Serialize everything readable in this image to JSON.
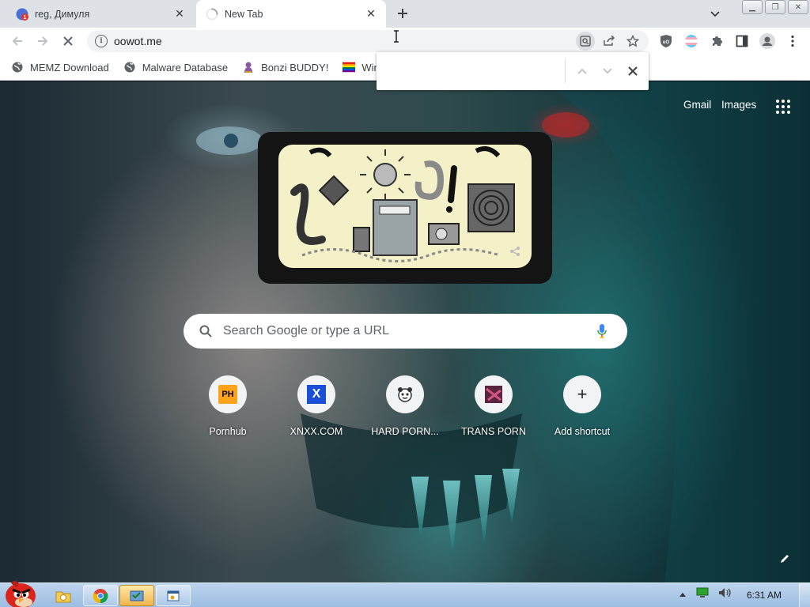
{
  "tabs": [
    {
      "title": "reg, Димуля",
      "favicon": "site-g-favicon",
      "active": false
    },
    {
      "title": "New Tab",
      "favicon": "loading-spinner-icon",
      "active": true
    }
  ],
  "toolbar": {
    "url": "oowot.me",
    "security_icon": "info-icon"
  },
  "bookmarks": [
    {
      "label": "MEMZ Download",
      "icon": "globe-icon"
    },
    {
      "label": "Malware Database",
      "icon": "globe-icon"
    },
    {
      "label": "Bonzi BUDDY!",
      "icon": "bonzi-icon"
    },
    {
      "label": "Wind",
      "icon": "windows-flag-icon"
    }
  ],
  "find_bar": {
    "value": ""
  },
  "ntp": {
    "gmail_label": "Gmail",
    "images_label": "Images",
    "search_placeholder": "Search Google or type a URL",
    "shortcuts": [
      {
        "label": "Pornhub",
        "fav_text": "PH"
      },
      {
        "label": "XNXX.COM",
        "fav_text": "X"
      },
      {
        "label": "HARD PORN...",
        "fav_text": ""
      },
      {
        "label": "TRANS PORN",
        "fav_text": ""
      },
      {
        "label": "Add shortcut",
        "fav_text": "+"
      }
    ]
  },
  "taskbar": {
    "clock": "6:31 AM"
  },
  "colors": {
    "tab_strip": "#dee1e6",
    "accent_blue": "#1a73e8",
    "mic_blue": "#4285f4",
    "taskbar": "#9cbde2"
  }
}
